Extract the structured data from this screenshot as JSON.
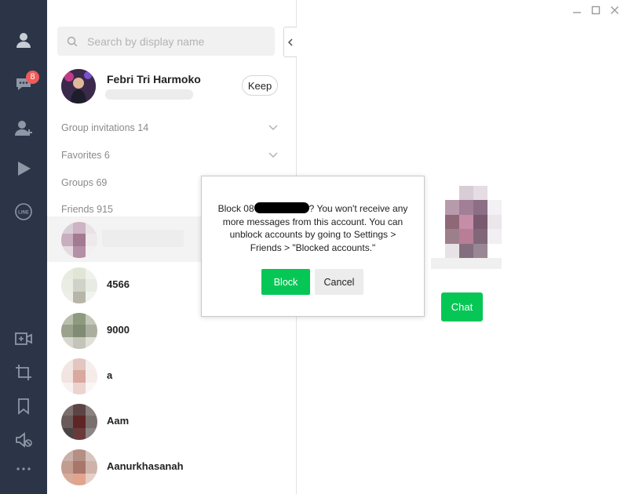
{
  "rail": {
    "unread_badge": "8",
    "icons": [
      "person-icon",
      "chats-icon",
      "add-friend-icon",
      "play-icon",
      "line-icon",
      "video-call-icon",
      "crop-icon",
      "bookmark-icon",
      "mute-icon",
      "more-icon"
    ]
  },
  "search": {
    "placeholder": "Search by display name"
  },
  "me": {
    "name": "Febri Tri Harmoko",
    "keep_label": "Keep"
  },
  "sections": {
    "group_invitations": "Group invitations 14",
    "favorites": "Favorites 6",
    "groups": "Groups 69",
    "friends": "Friends 915"
  },
  "friends": [
    {
      "name": ""
    },
    {
      "name": "4566"
    },
    {
      "name": "9000"
    },
    {
      "name": "a"
    },
    {
      "name": "Aam"
    },
    {
      "name": "Aanurkhasanah"
    }
  ],
  "dialog": {
    "text_part1": "Block 08",
    "text_part2": "? You won't receive any more messages from this account. You can unblock accounts by going to Settings > Friends > \"Blocked accounts.\"",
    "block_label": "Block",
    "cancel_label": "Cancel"
  },
  "profile": {
    "chat_label": "Chat"
  },
  "colors": {
    "rail_bg": "#2b3547",
    "accent_green": "#06c755",
    "badge_red": "#f25a5a"
  }
}
